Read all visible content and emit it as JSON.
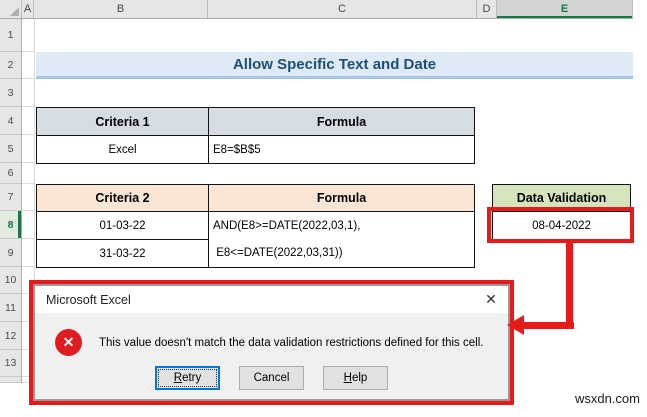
{
  "grid": {
    "column_headers": [
      "A",
      "B",
      "C",
      "D",
      "E"
    ],
    "row_numbers": [
      "1",
      "2",
      "3",
      "4",
      "5",
      "6",
      "7",
      "8",
      "9",
      "10",
      "11",
      "12",
      "13"
    ],
    "selected_column": "E",
    "selected_row": "8"
  },
  "banner": {
    "title": "Allow Specific Text and Date"
  },
  "table1": {
    "headers": [
      "Criteria 1",
      "Formula"
    ],
    "criteria_value": "Excel",
    "formula": "E8=$B$5"
  },
  "table2": {
    "headers": [
      "Criteria 2",
      "Formula"
    ],
    "criteria_values": [
      "01-03-22",
      "31-03-22"
    ],
    "formula_lines": [
      "AND(E8>=DATE(2022,03,1),",
      " E8<=DATE(2022,03,31))"
    ]
  },
  "validation": {
    "header": "Data Validation",
    "value": "08-04-2022"
  },
  "dialog": {
    "title": "Microsoft Excel",
    "close_icon": "✕",
    "message": "This value doesn't match the data validation restrictions defined for this cell.",
    "buttons": [
      {
        "label": "Retry",
        "accel": "R"
      },
      {
        "label": "Cancel",
        "accel": ""
      },
      {
        "label": "Help",
        "accel": "H"
      }
    ]
  },
  "watermark": "wsxdn.com",
  "colors": {
    "annotation_red": "#E51A1A",
    "error_icon_red": "#E11B22",
    "excel_green": "#107C41",
    "banner_bg": "#DEEAF6",
    "banner_border": "#A6C7E7",
    "banner_text": "#1F4E79",
    "table1_header_bg": "#D6DCE4",
    "table2_header_bg": "#FBE5D5",
    "validation_header_bg": "#D6E4BC",
    "dialog_body_bg": "#F0F0F0",
    "focus_border_blue": "#0078D7"
  }
}
